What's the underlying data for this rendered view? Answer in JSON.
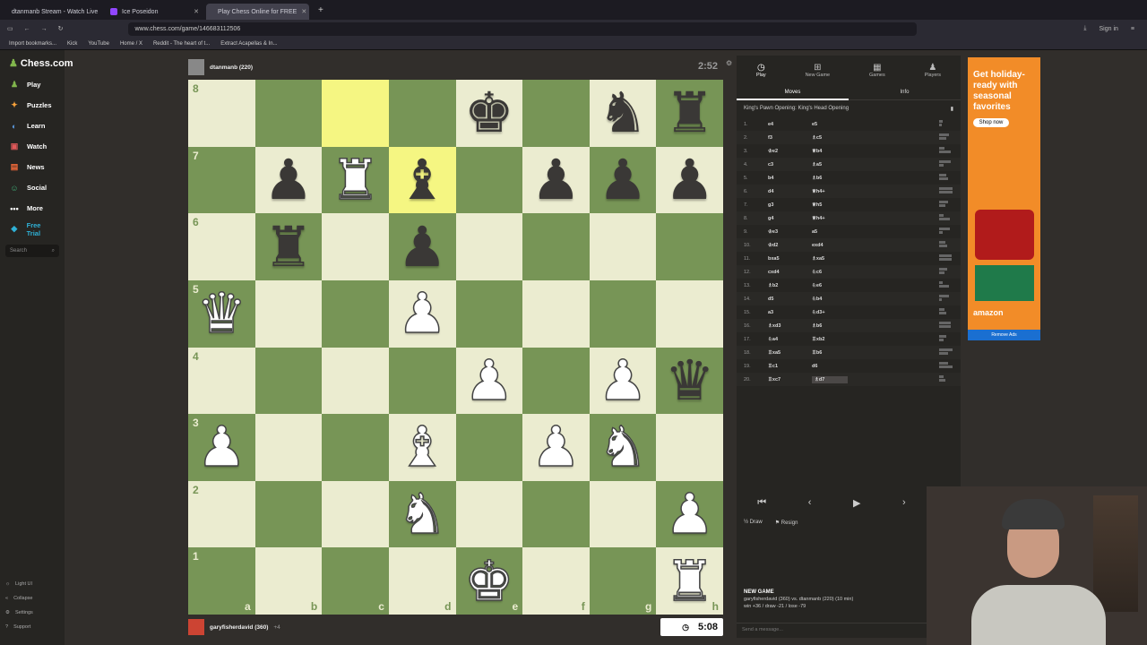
{
  "browser": {
    "tabs": [
      {
        "label": "dtanmanb Stream - Watch Live",
        "color": "#53fc18",
        "active": false
      },
      {
        "label": "Ice Poseidon",
        "color": "#9146ff",
        "active": false
      },
      {
        "label": "Play Chess Online for FREE",
        "color": "#81b64c",
        "active": true
      }
    ],
    "url": "www.chess.com/game/146683112506",
    "bookmarks": [
      "Import bookmarks...",
      "Kick",
      "YouTube",
      "Home / X",
      "Reddit - The heart of t...",
      "Extract Acapellas & In..."
    ],
    "sign_in": "Sign in"
  },
  "sidebar": {
    "logo": "Chess.com",
    "items": [
      {
        "label": "Play",
        "icon": "play-icon"
      },
      {
        "label": "Puzzles",
        "icon": "puzzle-icon"
      },
      {
        "label": "Learn",
        "icon": "learn-icon"
      },
      {
        "label": "Watch",
        "icon": "watch-icon"
      },
      {
        "label": "News",
        "icon": "news-icon"
      },
      {
        "label": "Social",
        "icon": "social-icon"
      },
      {
        "label": "More",
        "icon": "more-icon"
      },
      {
        "label": "Free Trial",
        "icon": "diamond-icon"
      }
    ],
    "search_placeholder": "Search",
    "bottom": [
      "Light UI",
      "Collapse",
      "Settings",
      "Support"
    ]
  },
  "top_player": {
    "name": "dtanmanb (220)",
    "clock": "2:52"
  },
  "bottom_player": {
    "name": "garyfisherdavid (360)",
    "clock": "5:08",
    "material": "+4"
  },
  "board": {
    "ranks": [
      "8",
      "7",
      "6",
      "5",
      "4",
      "3",
      "2",
      "1"
    ],
    "files": [
      "a",
      "b",
      "c",
      "d",
      "e",
      "f",
      "g",
      "h"
    ],
    "position": [
      [
        "",
        "",
        "",
        "",
        "bk",
        "",
        "bn",
        "br"
      ],
      [
        "",
        "bp",
        "wr",
        "bb",
        "",
        "bp",
        "bp",
        "bp"
      ],
      [
        "",
        "br",
        "",
        "bp",
        "",
        "",
        "",
        ""
      ],
      [
        "wq",
        "",
        "",
        "wp",
        "",
        "",
        "",
        ""
      ],
      [
        "",
        "",
        "",
        "",
        "wp",
        "",
        "wp",
        "bq"
      ],
      [
        "wp",
        "",
        "",
        "wb",
        "",
        "wp",
        "wn",
        ""
      ],
      [
        "",
        "",
        "",
        "wn",
        "",
        "",
        "",
        "wp"
      ],
      [
        "",
        "",
        "",
        "",
        "wk",
        "",
        "",
        "wr"
      ]
    ],
    "highlights": [
      "c8",
      "d7"
    ]
  },
  "panel": {
    "tabs": [
      {
        "label": "Play",
        "icon": "clock-icon"
      },
      {
        "label": "New Game",
        "icon": "plus-icon"
      },
      {
        "label": "Games",
        "icon": "board-icon"
      },
      {
        "label": "Players",
        "icon": "players-icon"
      }
    ],
    "subtabs": [
      "Moves",
      "Info"
    ],
    "opening": "King's Pawn Opening: King's Head Opening",
    "moves": [
      {
        "no": "1.",
        "w": "e4",
        "b": "e5"
      },
      {
        "no": "2.",
        "w": "f3",
        "b": "♗c5"
      },
      {
        "no": "3.",
        "w": "♔e2",
        "b": "♕b4"
      },
      {
        "no": "4.",
        "w": "c3",
        "b": "♗a5"
      },
      {
        "no": "5.",
        "w": "b4",
        "b": "♗b6"
      },
      {
        "no": "6.",
        "w": "d4",
        "b": "♕h4+"
      },
      {
        "no": "7.",
        "w": "g3",
        "b": "♕h5"
      },
      {
        "no": "8.",
        "w": "g4",
        "b": "♕h4+"
      },
      {
        "no": "9.",
        "w": "♔e3",
        "b": "a5"
      },
      {
        "no": "10.",
        "w": "♔d2",
        "b": "exd4"
      },
      {
        "no": "11.",
        "w": "bxa5",
        "b": "♗xa5"
      },
      {
        "no": "12.",
        "w": "cxd4",
        "b": "♘c6"
      },
      {
        "no": "13.",
        "w": "♗b2",
        "b": "♘e6"
      },
      {
        "no": "14.",
        "w": "d5",
        "b": "♘b4"
      },
      {
        "no": "15.",
        "w": "a3",
        "b": "♘d3+"
      },
      {
        "no": "16.",
        "w": "♗xd3",
        "b": "♗b6"
      },
      {
        "no": "17.",
        "w": "♘a4",
        "b": "♖xb2"
      },
      {
        "no": "18.",
        "w": "♖xa5",
        "b": "♖b6"
      },
      {
        "no": "19.",
        "w": "♖c1",
        "b": "d6"
      },
      {
        "no": "20.",
        "w": "♖xc7",
        "b": "♗d7"
      }
    ],
    "draw": "Draw",
    "resign": "Resign",
    "new_game_title": "NEW GAME",
    "new_game_line1": "garyfisherdavid (360) vs. dtanmanb (220) (10 min)",
    "new_game_line2": "win +36 / draw -21 / lose -79",
    "chat_placeholder": "Send a message..."
  },
  "ad": {
    "headline": "Get holiday-ready with seasonal favorites",
    "button": "Shop now",
    "brand": "amazon",
    "remove": "Remove Ads"
  }
}
